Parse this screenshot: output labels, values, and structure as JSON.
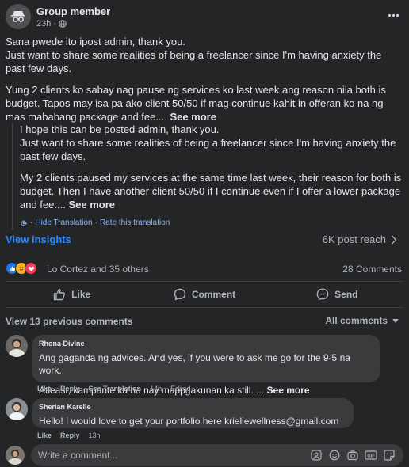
{
  "post": {
    "author": "Group member",
    "time": "23h",
    "audience_icon": "globe-icon",
    "body": [
      "Sana pwede ito ipost admin, thank you.\nJust want to share some realities of being a freelancer since I'm having anxiety the past few days.",
      "Yung 2 clients ko sabay nag pause ng services ko last week ang reason nila both is budget. Tapos may isa pa ako client 50/50 if mag continue kahit in offeran ko na ng mas mababang package and fee...."
    ],
    "see_more": "See more",
    "translation": [
      "I hope this can be posted admin, thank you.\nJust want to share some realities of being a freelancer since I'm having anxiety the past few days.",
      "My 2 clients paused my services at the same time last week, their reason for both is budget. Then I have another client 50/50 if I continue even if I offer a lower package and fee...."
    ],
    "hide_translation": "Hide Translation",
    "rate_translation": "Rate this translation",
    "translation_separator": "·"
  },
  "insights": {
    "link": "View insights",
    "reach": "6K post reach"
  },
  "reactions": {
    "names": "Lo Cortez and 35 others",
    "comments": "28 Comments",
    "icons": [
      "like-reaction-icon",
      "care-reaction-icon",
      "love-reaction-icon"
    ]
  },
  "actions": {
    "like": "Like",
    "comment": "Comment",
    "send": "Send"
  },
  "comments_header": {
    "view_previous": "View 13 previous comments",
    "sort": "All comments"
  },
  "comments": [
    {
      "name": "Rhona Divine",
      "lines": [
        "Ang gaganda ng advices. And yes, if you were to ask me go for the 9-5 na work.",
        "Atleast, kampante ka na nay mappgakunan ka still. ..."
      ],
      "see_more": "See more",
      "like": "Like",
      "reply": "Reply",
      "see_translation": "See Translation",
      "time": "14h",
      "edited": "Edited"
    },
    {
      "name": "Sherian Karelle",
      "lines": [
        "Hello! I would love to get your portfolio here kriellewellness@gmail.com"
      ],
      "like": "Like",
      "reply": "Reply",
      "time": "13h"
    }
  ],
  "composer": {
    "placeholder": "Write a comment...",
    "icons": [
      "avatar-sticker-icon",
      "emoji-icon",
      "camera-icon",
      "gif-icon",
      "sticker-icon"
    ]
  },
  "colors": {
    "background": "#242526",
    "bubble": "#3a3b3c",
    "link_blue": "#2d88ff",
    "like_blue": "#1877f2",
    "love_red": "#f33e58",
    "care_yellow": "#f7b125"
  }
}
